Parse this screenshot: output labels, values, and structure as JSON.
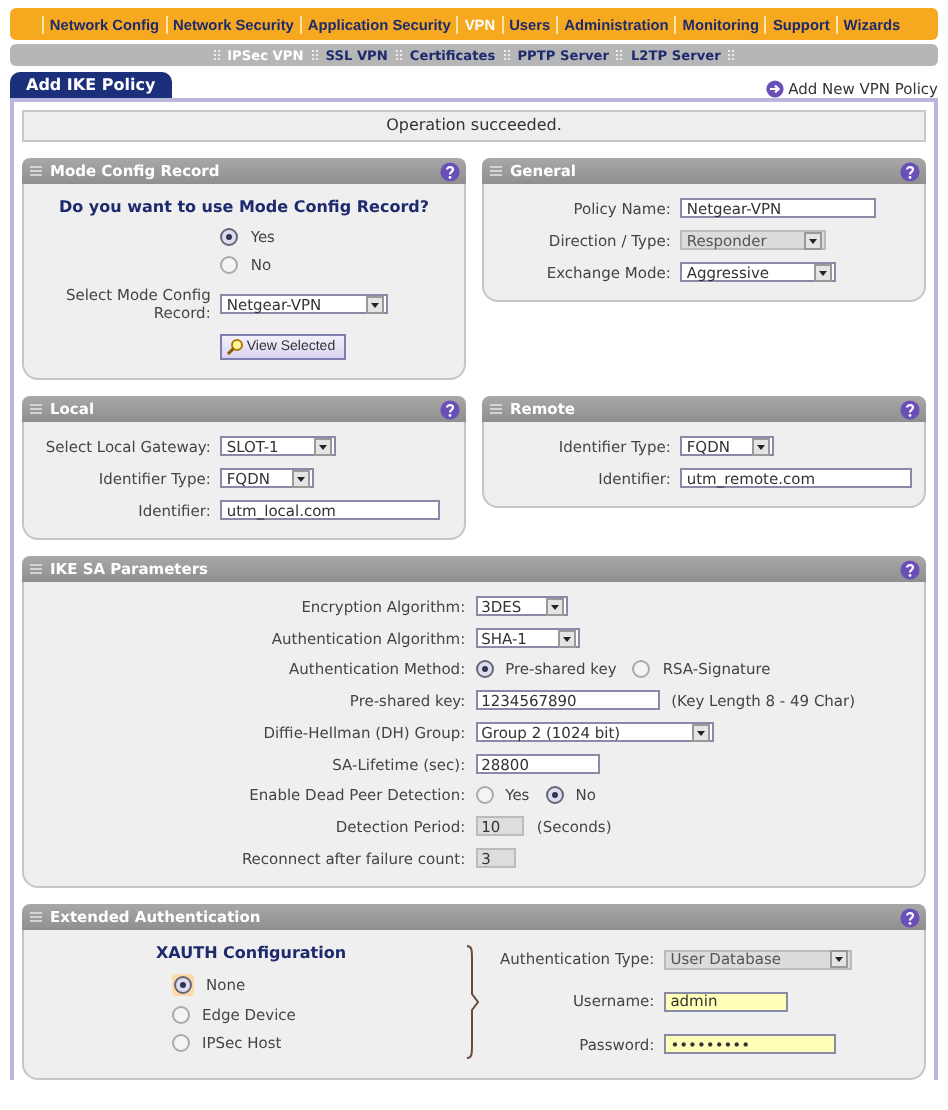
{
  "nav": [
    {
      "label": "Network Config",
      "selected": false
    },
    {
      "label": "Network Security",
      "selected": false
    },
    {
      "label": "Application Security",
      "selected": false
    },
    {
      "label": "VPN",
      "selected": true
    },
    {
      "label": "Users",
      "selected": false
    },
    {
      "label": "Administration",
      "selected": false
    },
    {
      "label": "Monitoring",
      "selected": false
    },
    {
      "label": "Support",
      "selected": false
    },
    {
      "label": "Wizards",
      "selected": false
    }
  ],
  "subnav": [
    {
      "label": "IPSec VPN",
      "selected": true
    },
    {
      "label": "SSL VPN",
      "selected": false
    },
    {
      "label": "Certificates",
      "selected": false
    },
    {
      "label": "PPTP Server",
      "selected": false
    },
    {
      "label": "L2TP Server",
      "selected": false
    }
  ],
  "page_tab": {
    "label": "Add IKE Policy",
    "selected": true
  },
  "action_link": "Add New VPN Policy",
  "message": "Operation succeeded.",
  "section_rows": [
    [
      {
        "title": "Mode Config Record",
        "columns": [
          [
            {
              "kind": "heading",
              "text": "Do you want to use Mode Config Record?"
            },
            {
              "kind": "radio_list",
              "options": [
                {
                  "label": "Yes",
                  "selected": true
                },
                {
                  "label": "No",
                  "selected": false
                }
              ]
            },
            {
              "kind": "select",
              "label": "Select Mode Config Record:",
              "value": "Netgear-VPN",
              "disabled": false
            },
            {
              "kind": "button",
              "label": "View Selected"
            }
          ]
        ]
      },
      {
        "title": "General",
        "columns": [
          [
            {
              "kind": "input",
              "label": "Policy Name:",
              "value": "Netgear-VPN",
              "disabled": false,
              "highlighted": false
            },
            {
              "kind": "select",
              "label": "Direction / Type:",
              "value": "Responder",
              "disabled": true
            },
            {
              "kind": "select",
              "label": "Exchange Mode:",
              "value": "Aggressive",
              "disabled": false
            }
          ]
        ]
      }
    ],
    [
      {
        "title": "Local",
        "columns": [
          [
            {
              "kind": "select",
              "label": "Select Local Gateway:",
              "value": "SLOT-1",
              "disabled": false
            },
            {
              "kind": "select",
              "label": "Identifier Type:",
              "value": "FQDN",
              "disabled": false
            },
            {
              "kind": "input",
              "label": "Identifier:",
              "value": "utm_local.com",
              "disabled": false,
              "highlighted": false
            }
          ]
        ]
      },
      {
        "title": "Remote",
        "columns": [
          [
            {
              "kind": "select",
              "label": "Identifier Type:",
              "value": "FQDN",
              "disabled": false
            },
            {
              "kind": "input",
              "label": "Identifier:",
              "value": "utm_remote.com",
              "disabled": false,
              "highlighted": false
            }
          ]
        ]
      }
    ],
    [
      {
        "title": "IKE SA Parameters",
        "columns": [
          [
            {
              "kind": "select",
              "label": "Encryption Algorithm:",
              "value": "3DES",
              "disabled": false
            },
            {
              "kind": "select",
              "label": "Authentication Algorithm:",
              "value": "SHA-1",
              "disabled": false
            },
            {
              "kind": "radio_group",
              "label": "Authentication Method:",
              "options": [
                {
                  "label": "Pre-shared key",
                  "selected": true
                },
                {
                  "label": "RSA-Signature",
                  "selected": false
                }
              ]
            },
            {
              "kind": "input",
              "label": "Pre-shared key:",
              "value": "1234567890",
              "disabled": false,
              "highlighted": false,
              "note": "(Key Length 8 - 49 Char)"
            },
            {
              "kind": "select",
              "label": "Diffie-Hellman (DH) Group:",
              "value": "Group 2 (1024 bit)",
              "disabled": false
            },
            {
              "kind": "input",
              "label": "SA-Lifetime (sec):",
              "value": "28800",
              "disabled": false,
              "highlighted": false
            },
            {
              "kind": "radio_group",
              "label": "Enable Dead Peer Detection:",
              "options": [
                {
                  "label": "Yes",
                  "selected": false
                },
                {
                  "label": "No",
                  "selected": true
                }
              ]
            },
            {
              "kind": "input",
              "label": "Detection Period:",
              "value": "10",
              "disabled": true,
              "highlighted": false,
              "note": "(Seconds)"
            },
            {
              "kind": "input",
              "label": "Reconnect after failure count:",
              "value": "3",
              "disabled": true,
              "highlighted": false
            }
          ]
        ]
      }
    ],
    [
      {
        "title": "Extended Authentication",
        "columns": [
          [
            {
              "kind": "heading",
              "text": "XAUTH Configuration"
            },
            {
              "kind": "radio_list",
              "options": [
                {
                  "label": "None",
                  "selected": true
                },
                {
                  "label": "Edge Device",
                  "selected": false
                },
                {
                  "label": "IPSec Host",
                  "selected": false
                }
              ]
            }
          ],
          [
            {
              "kind": "select",
              "label": "Authentication Type:",
              "value": "User Database",
              "disabled": true
            },
            {
              "kind": "input",
              "label": "Username:",
              "value": "admin",
              "disabled": false,
              "highlighted": true
            },
            {
              "kind": "password",
              "label": "Password:",
              "value": "•••••••••",
              "disabled": false,
              "highlighted": true
            }
          ]
        ]
      }
    ]
  ]
}
